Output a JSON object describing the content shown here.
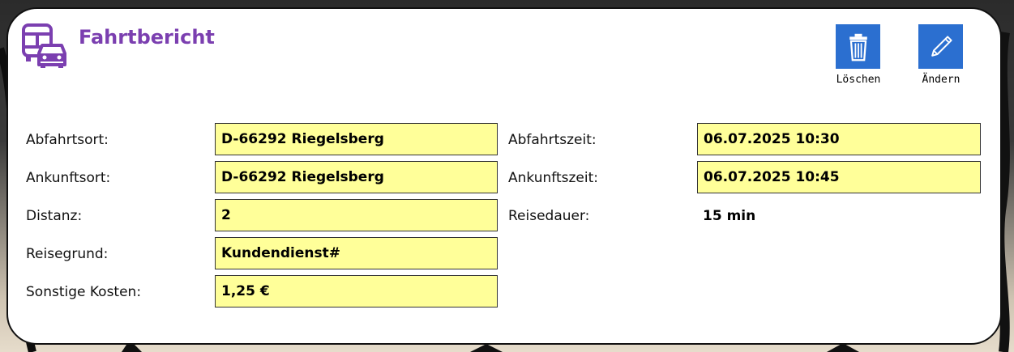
{
  "header": {
    "title": "Fahrtbericht",
    "icon": "vehicles-icon",
    "accent": "#7b3fb0"
  },
  "actions": {
    "delete_label": "Löschen",
    "edit_label": "Ändern",
    "button_color": "#2b6fd0"
  },
  "left": {
    "departure_place": {
      "label": "Abfahrtsort:",
      "value": "D-66292 Riegelsberg"
    },
    "arrival_place": {
      "label": "Ankunftsort:",
      "value": "D-66292 Riegelsberg"
    },
    "distance": {
      "label": "Distanz:",
      "value": "2"
    },
    "purpose": {
      "label": "Reisegrund:",
      "value": "Kundendienst#"
    },
    "other_costs": {
      "label": "Sonstige Kosten:",
      "value": "1,25 €"
    }
  },
  "right": {
    "departure_time": {
      "label": "Abfahrtszeit:",
      "value": "06.07.2025 10:30"
    },
    "arrival_time": {
      "label": "Ankunftszeit:",
      "value": "06.07.2025 10:45"
    },
    "duration": {
      "label": "Reisedauer:",
      "value": "15 min"
    }
  },
  "field_background": "#ffff99"
}
